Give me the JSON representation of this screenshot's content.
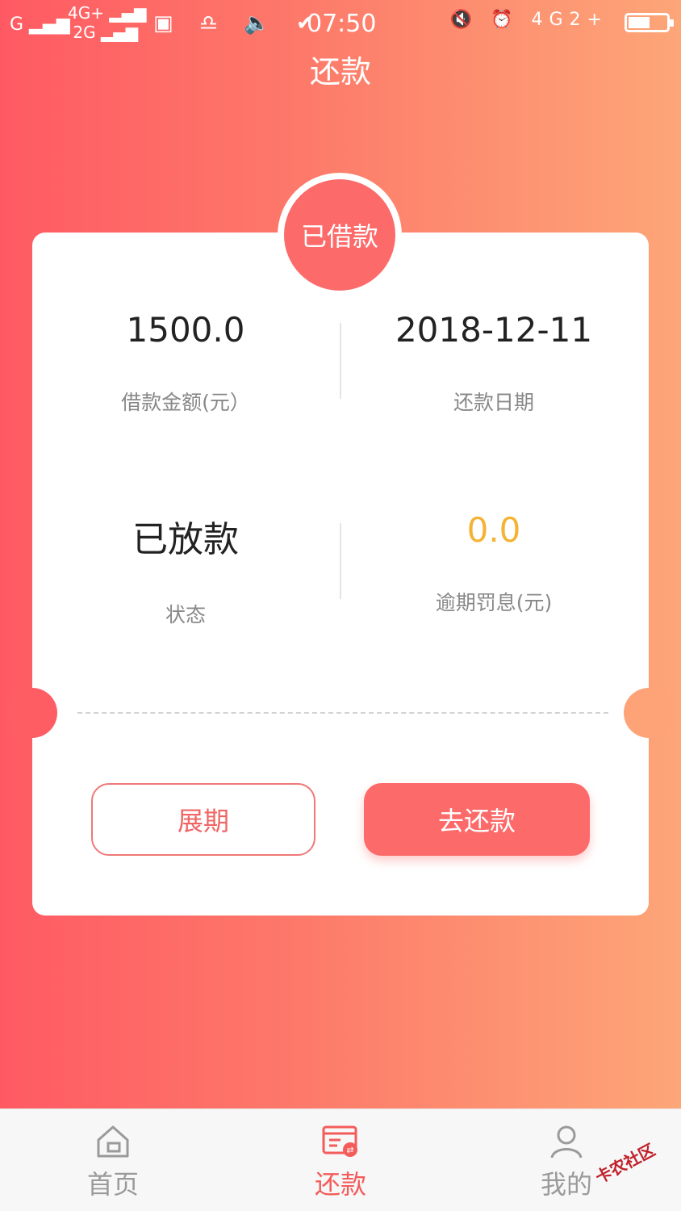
{
  "status_bar": {
    "signal_left": "G",
    "network_top": "4G+",
    "network_bottom": "2G",
    "time": "07:50",
    "network_right": "4G2+"
  },
  "header": {
    "title": "还款"
  },
  "card": {
    "badge": "已借款",
    "loan_amount": {
      "value": "1500.0",
      "label": "借款金额(元）"
    },
    "repay_date": {
      "value": "2018-12-11",
      "label": "还款日期"
    },
    "status": {
      "value": "已放款",
      "label": "状态"
    },
    "penalty": {
      "value": "0.0",
      "label": "逾期罚息(元)"
    },
    "extend_button": "展期",
    "pay_button": "去还款"
  },
  "tabbar": {
    "home": {
      "label": "首页",
      "icon": "home-icon"
    },
    "repay": {
      "label": "还款",
      "icon": "bill-icon",
      "active": true
    },
    "mine": {
      "label": "我的",
      "icon": "user-icon"
    }
  },
  "watermark": "卡农社区",
  "colors": {
    "accent": "#fd6a6a",
    "penalty": "#f5b335",
    "gradient_start": "#ff5a63",
    "gradient_end": "#fda678"
  }
}
